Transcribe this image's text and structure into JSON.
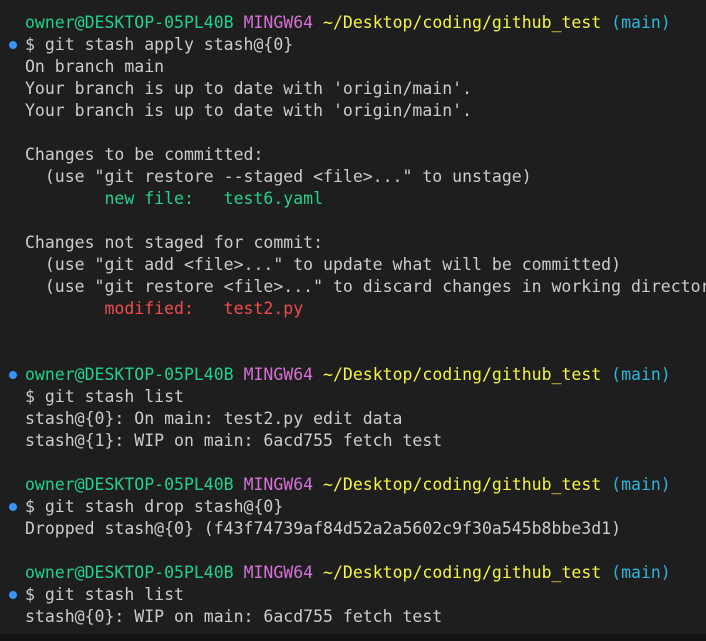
{
  "prompt": {
    "user": "owner@DESKTOP-05PL40B",
    "shell": "MINGW64",
    "path": "~/Desktop/coding/github_test",
    "branch": "(main)"
  },
  "blocks": [
    {
      "command": "$ git stash apply stash@{0}",
      "output": [
        "On branch main",
        "Your branch is up to date with 'origin/main'.",
        "Your branch is up to date with 'origin/main'.",
        "",
        "Changes to be committed:",
        "  (use \"git restore --staged <file>...\" to unstage)",
        "        new file:   test6.yaml",
        "",
        "Changes not staged for commit:",
        "  (use \"git add <file>...\" to update what will be committed)",
        "  (use \"git restore <file>...\" to discard changes in working directory)",
        "        modified:   test2.py",
        "",
        ""
      ]
    },
    {
      "command": "$ git stash list",
      "output": [
        "stash@{0}: On main: test2.py edit data",
        "stash@{1}: WIP on main: 6acd755 fetch test",
        ""
      ]
    },
    {
      "command": "$ git stash drop stash@{0}",
      "output": [
        "Dropped stash@{0} (f43f74739af84d52a2a5602c9f30a545b8bbe3d1)",
        ""
      ]
    },
    {
      "command": "$ git stash list",
      "output": [
        "stash@{0}: WIP on main: 6acd755 fetch test"
      ]
    }
  ],
  "colors": {
    "background": "#1e1e1e",
    "text": "#cccccc",
    "user": "#23d18b",
    "shell": "#d670d6",
    "path": "#f5f543",
    "branch": "#29b8db",
    "staged": "#23d18b",
    "unstaged": "#f14c4c",
    "command-decoration": "#3794ff"
  }
}
